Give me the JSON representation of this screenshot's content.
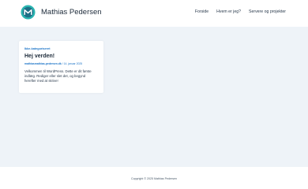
{
  "header": {
    "site_title": "Mathias Pedersen",
    "logo_icon": "site-logo-icon",
    "nav": [
      {
        "label": "Forside"
      },
      {
        "label": "Hvem er jeg?"
      },
      {
        "label": "Servere og projekter"
      }
    ]
  },
  "post": {
    "category": "Ikke-kategoriseret",
    "title": "Hej verden!",
    "author": "mathiasmathias-pedersen.dk",
    "date": "14. januar 2025",
    "excerpt_lines": [
      "Velkommen til WordPress. Dette er dit første",
      "indlæg. Rediger eller slet det, og begynd",
      "herefter med at skrive!"
    ]
  },
  "footer": {
    "copyright": "Copyright © 2025 Mathias Pedersen"
  },
  "colors": {
    "accent": "#1a73c7",
    "logo_teal": "#2bb5b0",
    "background": "#eef3f8"
  }
}
